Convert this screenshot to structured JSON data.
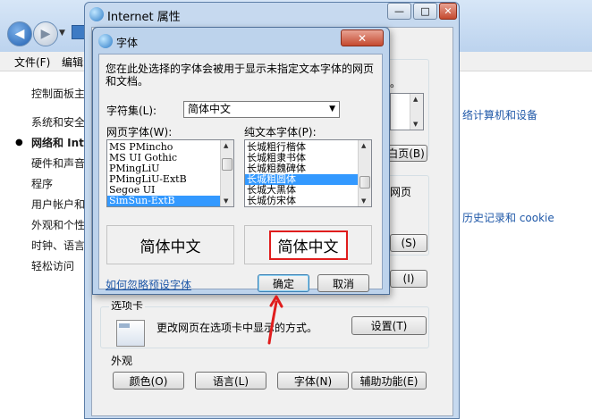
{
  "control_panel": {
    "menu": [
      "文件(F)",
      "编辑"
    ],
    "left_items": [
      "控制面板主",
      "系统和安全",
      "网络和 Int",
      "硬件和声音",
      "程序",
      "用户帐户和",
      "外观和个性",
      "时钟、语言",
      "轻松访问"
    ],
    "right_links": [
      "络计算机和设备",
      "历史记录和 cookie"
    ]
  },
  "internet_properties": {
    "title": "Internet 属性",
    "title_buttons": [
      "—",
      "□",
      "✕"
    ],
    "partial_texts": {
      "dot": "。",
      "page_btn": "白页(B)",
      "webpage": "网页",
      "btn_s": "(S)",
      "btn_i": "(I)"
    },
    "tabs_section": {
      "label": "选项卡",
      "description": "更改网页在选项卡中显示的方式。",
      "settings_button": "设置(T)"
    },
    "appearance": {
      "label": "外观",
      "buttons": [
        "颜色(O)",
        "语言(L)",
        "字体(N)",
        "辅助功能(E)"
      ]
    }
  },
  "font_dialog": {
    "title": "字体",
    "close": "✕",
    "description": "您在此处选择的字体会被用于显示未指定文本字体的网页和文档。",
    "charset_label": "字符集(L):",
    "charset_value": "简体中文",
    "webpage_font_label": "网页字体(W):",
    "webpage_fonts": [
      "MS PMincho",
      "MS UI Gothic",
      "PMingLiU",
      "PMingLiU-ExtB",
      "Segoe UI",
      "SimSun-ExtB"
    ],
    "webpage_font_selected": "SimSun-ExtB",
    "plaintext_font_label": "纯文本字体(P):",
    "plaintext_fonts": [
      "长城粗行楷体",
      "长城粗隶书体",
      "长城粗魏碑体",
      "长城粗圆体",
      "长城大黑体",
      "长城仿宋体"
    ],
    "plaintext_font_selected": "长城粗圆体",
    "preview_left": "简体中文",
    "preview_right": "简体中文",
    "ignore_link": "如何忽略预设字体",
    "ok": "确定",
    "cancel": "取消"
  },
  "colors": {
    "accent_link": "#1f58a8",
    "selection": "#3399ff",
    "annotation_red": "#e01d1d"
  }
}
